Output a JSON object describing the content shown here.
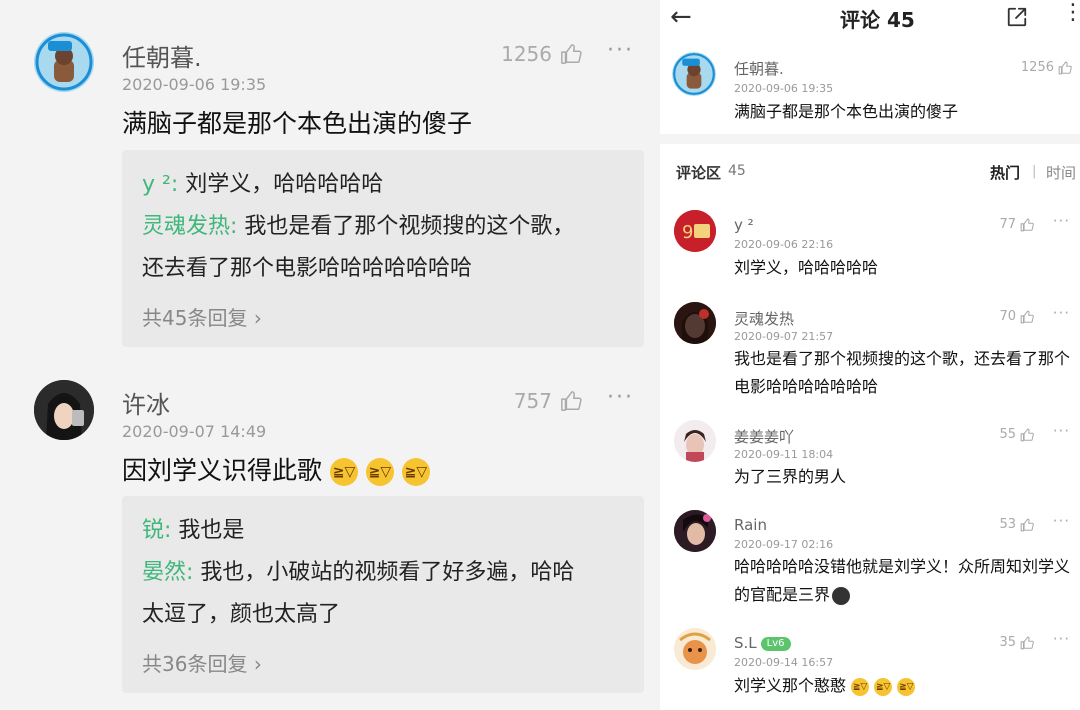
{
  "left": {
    "comments": [
      {
        "name": "任朝暮.",
        "time": "2020-09-06 19:35",
        "likes": "1256",
        "text": "满脑子都是那个本色出演的傻子",
        "replies": [
          {
            "name": "y ²:",
            "text": " 刘学义，哈哈哈哈哈"
          },
          {
            "name": "灵魂发热:",
            "text": " 我也是看了那个视频搜的这个歌，"
          },
          {
            "name": "",
            "text": "还去看了那个电影哈哈哈哈哈哈哈"
          }
        ],
        "reply_count": "共45条回复"
      },
      {
        "name": "许冰",
        "time": "2020-09-07 14:49",
        "likes": "757",
        "text": "因刘学义识得此歌",
        "replies": [
          {
            "name": "锐:",
            "text": " 我也是"
          },
          {
            "name": "晏然:",
            "text": " 我也，小破站的视频看了好多遍，哈哈"
          },
          {
            "name": "",
            "text": "太逗了，颜也太高了"
          }
        ],
        "reply_count": "共36条回复"
      }
    ],
    "more_glyph": "···"
  },
  "right": {
    "title": "评论 45",
    "op": {
      "name": "任朝暮.",
      "time": "2020-09-06 19:35",
      "likes": "1256",
      "text": "满脑子都是那个本色出演的傻子"
    },
    "section": {
      "title": "评论区",
      "count": "45",
      "hot": "热门",
      "sep": "|",
      "time": "时间"
    },
    "comments": [
      {
        "name": "y ²",
        "time": "2020-09-06 22:16",
        "likes": "77",
        "text": "刘学义，哈哈哈哈哈"
      },
      {
        "name": "灵魂发热",
        "time": "2020-09-07 21:57",
        "likes": "70",
        "text": "我也是看了那个视频搜的这个歌，还去看了那个电影哈哈哈哈哈哈哈"
      },
      {
        "name": "姜姜姜吖",
        "time": "2020-09-11 18:04",
        "likes": "55",
        "text": "为了三界的男人"
      },
      {
        "name": "Rain",
        "time": "2020-09-17 02:16",
        "likes": "53",
        "text": "哈哈哈哈哈没错他就是刘学义！众所周知刘学义的官配是三界"
      },
      {
        "name": "S.L",
        "badge": "Lv6",
        "time": "2020-09-14 16:57",
        "likes": "35",
        "text": "刘学义那个憨憨"
      }
    ]
  },
  "colors": {
    "reply_name": "#3fb67a",
    "badge": "#5cc46b",
    "avatar_badge": "#1a8fd6"
  },
  "icons": [
    "thumb-up-icon",
    "more-icon",
    "back-arrow-icon",
    "share-icon",
    "laughing-emoji-icon",
    "dark-emoji-icon"
  ]
}
